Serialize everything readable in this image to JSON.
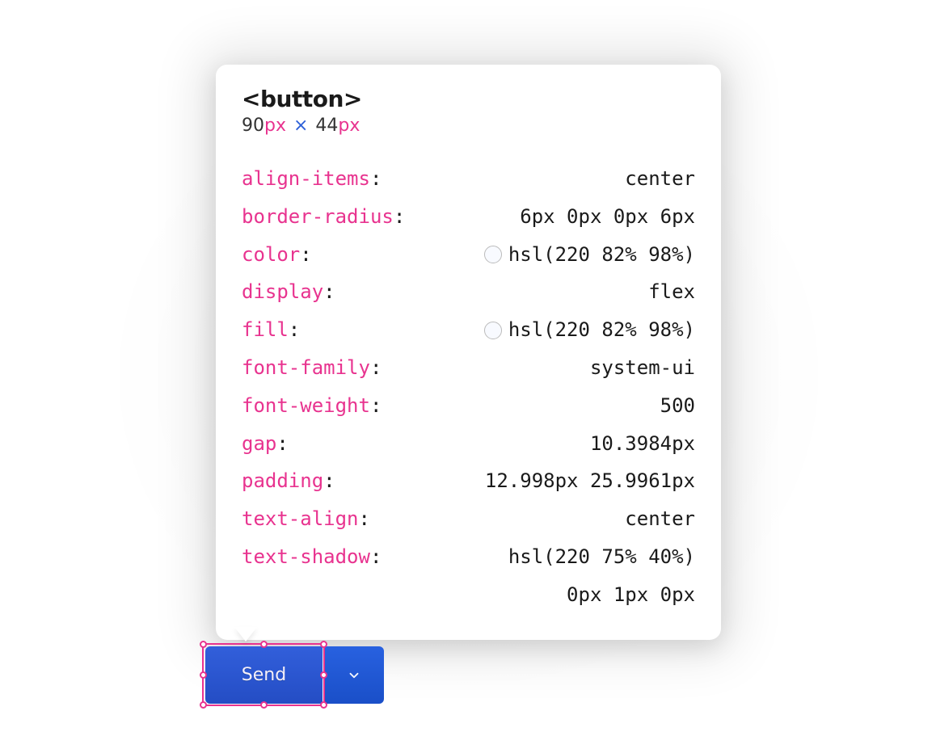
{
  "tooltip": {
    "element_tag": "<button>",
    "width": "90",
    "width_unit": "px",
    "height": "44",
    "height_unit": "px",
    "separator": "×",
    "properties": [
      {
        "name": "align-items",
        "value": "center",
        "swatch": false
      },
      {
        "name": "border-radius",
        "value": "6px 0px 0px 6px",
        "swatch": false
      },
      {
        "name": "color",
        "value": "hsl(220 82% 98%)",
        "swatch": true
      },
      {
        "name": "display",
        "value": "flex",
        "swatch": false
      },
      {
        "name": "fill",
        "value": "hsl(220 82% 98%)",
        "swatch": true
      },
      {
        "name": "font-family",
        "value": "system-ui",
        "swatch": false
      },
      {
        "name": "font-weight",
        "value": "500",
        "swatch": false
      },
      {
        "name": "gap",
        "value": "10.3984px",
        "swatch": false
      },
      {
        "name": "padding",
        "value": "12.998px 25.9961px",
        "swatch": false
      },
      {
        "name": "text-align",
        "value": "center",
        "swatch": false
      },
      {
        "name": "text-shadow",
        "value": "hsl(220 75% 40%)",
        "value2": "0px 1px 0px",
        "swatch": false
      }
    ]
  },
  "button": {
    "send_label": "Send"
  }
}
